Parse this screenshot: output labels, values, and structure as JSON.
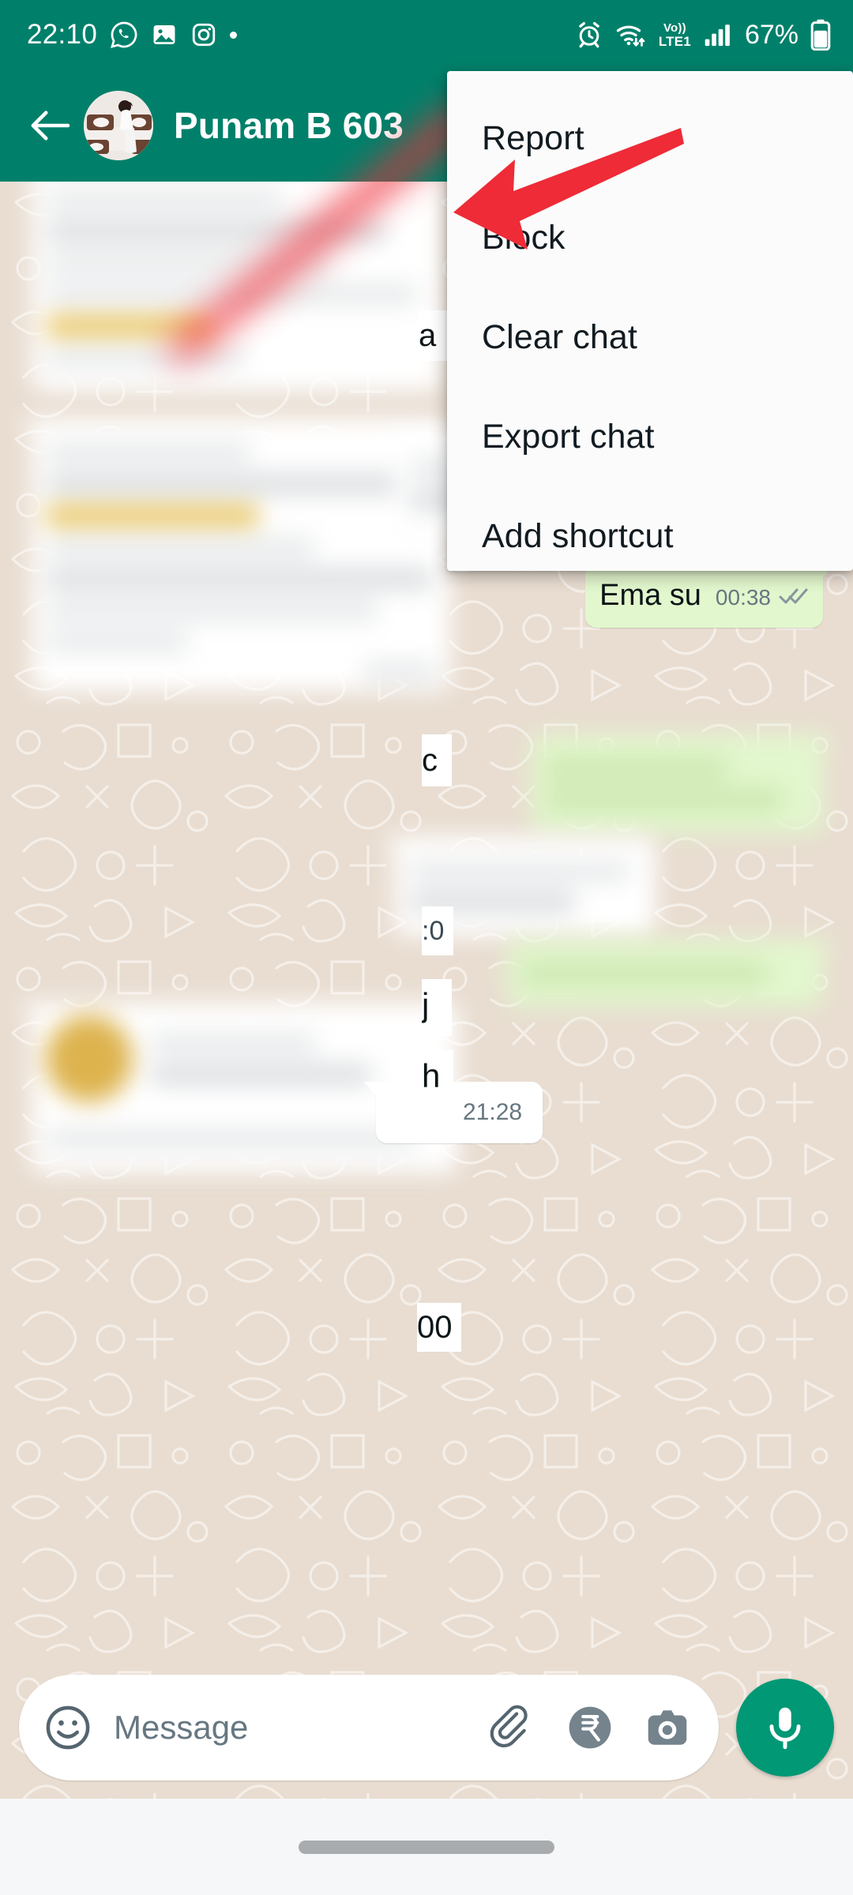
{
  "status_bar": {
    "time": "22:10",
    "left_icons": [
      "whatsapp-icon",
      "photos-icon",
      "instagram-icon",
      "more-notifications-dot"
    ],
    "right_icons": [
      "alarm-icon",
      "wifi-icon",
      "volte-icon",
      "signal-icon",
      "battery-icon"
    ],
    "network_label_line1": "Vo))",
    "network_label_line2": "LTE1",
    "battery_percent": "67%"
  },
  "app_bar": {
    "back_icon": "back-arrow-icon",
    "avatar": "contact-avatar",
    "contact_name": "Punam B 603"
  },
  "overflow_menu": {
    "items": [
      {
        "label": "Report"
      },
      {
        "label": "Block"
      },
      {
        "label": "Clear chat"
      },
      {
        "label": "Export chat"
      },
      {
        "label": "Add shortcut"
      }
    ],
    "highlighted_item": "Block"
  },
  "annotation": {
    "type": "arrow",
    "color": "#ee2b37",
    "points_to": "Block"
  },
  "chat": {
    "messages": [
      {
        "side": "in",
        "text": "",
        "time": "",
        "redacted": true
      },
      {
        "side": "out",
        "text": "Ema su",
        "time": "00:38",
        "status": "delivered",
        "redacted": false
      },
      {
        "side": "in",
        "text": "",
        "time": "",
        "redacted": true
      },
      {
        "side": "in",
        "text": "",
        "time": "",
        "redacted": true
      },
      {
        "side": "out",
        "text": "",
        "time": "",
        "redacted": true
      },
      {
        "side": "in",
        "text": "",
        "time": "",
        "redacted": true
      },
      {
        "side": "out",
        "text": "",
        "time": "",
        "redacted": true
      },
      {
        "side": "in",
        "text": "",
        "time": "21:28",
        "redacted": true
      }
    ],
    "visible_fragments": [
      "a",
      "c",
      ":0",
      "j",
      "h",
      "00"
    ]
  },
  "composer": {
    "emoji_icon": "emoji-icon",
    "placeholder": "Message",
    "attach_icon": "paperclip-icon",
    "payment_icon": "rupee-icon",
    "camera_icon": "camera-icon",
    "mic_icon": "microphone-icon"
  },
  "nav_bar": {
    "gesture_pill": "home-gesture-pill"
  },
  "colors": {
    "header_green": "#00806a",
    "mic_green": "#009875",
    "outgoing_bubble": "#e2f7cd",
    "incoming_bubble": "#ffffff",
    "wallpaper": "#e9ddd1",
    "annotation_red": "#ee2b37",
    "highlight_yellow": "#e8c35d"
  }
}
